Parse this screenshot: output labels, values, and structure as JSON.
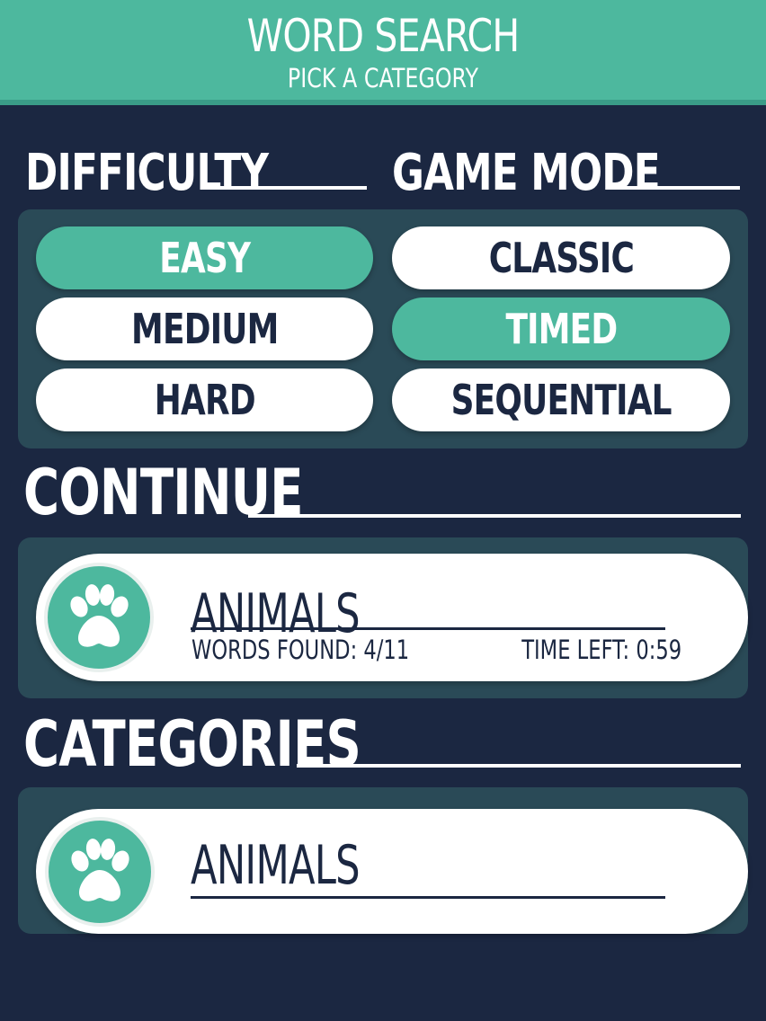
{
  "header": {
    "title": "WORD SEARCH",
    "subtitle": "PICK A CATEGORY"
  },
  "difficulty": {
    "title": "DIFFICULTY",
    "options": [
      {
        "label": "EASY",
        "selected": true
      },
      {
        "label": "MEDIUM",
        "selected": false
      },
      {
        "label": "HARD",
        "selected": false
      }
    ]
  },
  "game_mode": {
    "title": "GAME MODE",
    "options": [
      {
        "label": "CLASSIC",
        "selected": false
      },
      {
        "label": "TIMED",
        "selected": true
      },
      {
        "label": "SEQUENTIAL",
        "selected": false
      }
    ]
  },
  "continue_section": {
    "title": "CONTINUE",
    "card": {
      "icon": "paw-icon",
      "name": "ANIMALS",
      "words_found": "WORDS FOUND: 4/11",
      "time_left": "TIME LEFT: 0:59"
    }
  },
  "categories_section": {
    "title": "CATEGORIES",
    "items": [
      {
        "icon": "paw-icon",
        "name": "ANIMALS"
      }
    ]
  },
  "colors": {
    "background": "#1b2741",
    "accent": "#4db89e",
    "panel": "#2a4a57",
    "pill": "#ffffff"
  }
}
